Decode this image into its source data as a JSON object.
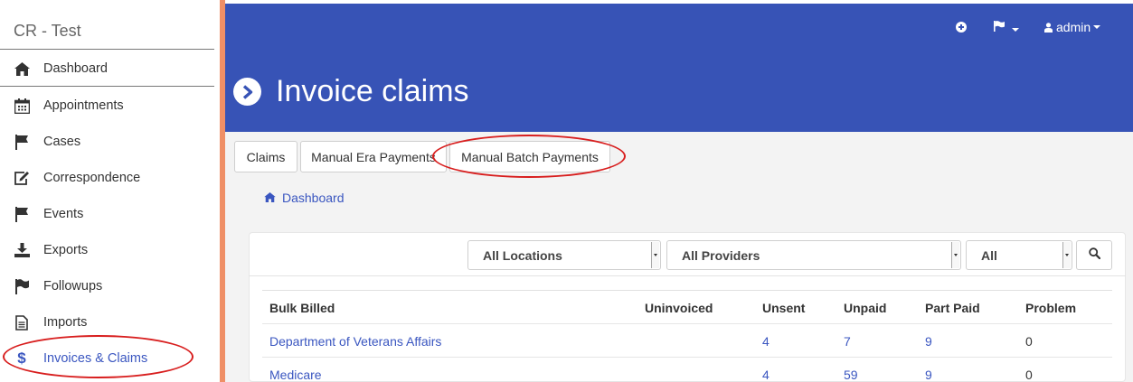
{
  "app": {
    "title": "CR - Test"
  },
  "sidebar": {
    "items": [
      {
        "label": "Dashboard",
        "icon": "home-icon"
      },
      {
        "label": "Appointments",
        "icon": "calendar-icon"
      },
      {
        "label": "Cases",
        "icon": "flag-icon"
      },
      {
        "label": "Correspondence",
        "icon": "edit-icon"
      },
      {
        "label": "Events",
        "icon": "flag-icon"
      },
      {
        "label": "Exports",
        "icon": "download-icon"
      },
      {
        "label": "Followups",
        "icon": "flag-icon"
      },
      {
        "label": "Imports",
        "icon": "document-icon"
      },
      {
        "label": "Invoices & Claims",
        "icon": "dollar-icon",
        "active": true,
        "icon_glyph": "$"
      }
    ]
  },
  "header": {
    "user": "admin",
    "page_title": "Invoice claims",
    "color": "#3753b6"
  },
  "tabs": [
    {
      "label": "Claims"
    },
    {
      "label": "Manual Era Payments"
    },
    {
      "label": "Manual Batch Payments"
    }
  ],
  "breadcrumb": {
    "label": "Dashboard"
  },
  "filters": {
    "location": "All Locations",
    "provider": "All Providers",
    "status": "All"
  },
  "table": {
    "headers": [
      "Bulk Billed",
      "Uninvoiced",
      "Unsent",
      "Unpaid",
      "Part Paid",
      "Problem"
    ],
    "rows": [
      {
        "name": "Department of Veterans Affairs",
        "uninvoiced": "",
        "unsent": "4",
        "unpaid": "7",
        "part_paid": "9",
        "problem": "0"
      },
      {
        "name": "Medicare",
        "uninvoiced": "",
        "unsent": "4",
        "unpaid": "59",
        "part_paid": "9",
        "problem": "0"
      }
    ]
  },
  "colors": {
    "accent": "#3a56c0",
    "sidebar_accent": "#ef8f66",
    "annotation": "#d81e1e"
  }
}
